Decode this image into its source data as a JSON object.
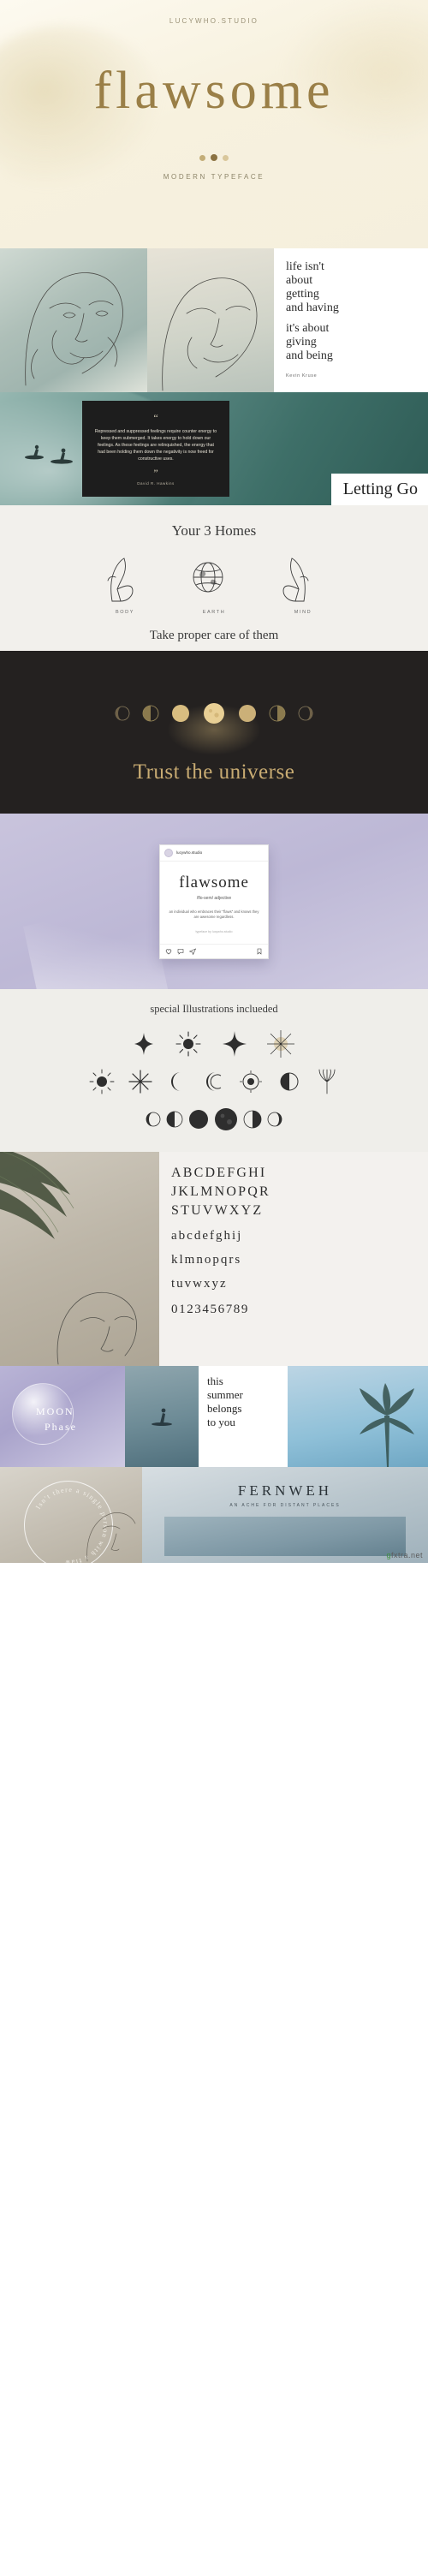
{
  "hero": {
    "brand": "LUCYWHO.STUDIO",
    "title": "flawsome",
    "subtitle": "MODERN TYPEFACE",
    "accent": "#9a7f47",
    "bg": "#f5efdd"
  },
  "quote_section": {
    "lines": [
      "life isn't",
      "about",
      "getting",
      "and having",
      "it's about",
      "giving",
      "and being"
    ],
    "author": "Kevin Kruse"
  },
  "dark_quote": {
    "open_mark": "“",
    "text": "Repressed and suppressed feelings require counter energy to keep them submerged. It takes energy to hold down our feelings. As these feelings are relinquished, the energy that had been holding them down the negativity is now freed for constructive uses.",
    "close_mark": "”",
    "author": "David R. Hawkins",
    "overlay_title": "Letting Go",
    "card_bg": "#1d1d1d"
  },
  "homes": {
    "title": "Your 3 Homes",
    "items": [
      {
        "icon": "hand-body-icon",
        "caption": "BODY"
      },
      {
        "icon": "earth-globe-icon",
        "caption": "EARTH"
      },
      {
        "icon": "hand-mind-icon",
        "caption": "MIND"
      }
    ],
    "footer": "Take proper care of them"
  },
  "universe": {
    "title": "Trust the universe",
    "bg": "#242120",
    "accent": "#c8ab72",
    "moon_count": 7
  },
  "instagram": {
    "username": "lucywho.studio",
    "word": "flawsome",
    "pronunciation": "/flo-sem/   adjective",
    "definition": "an individual who embraces their \"flaws\" and knows they are awesome regardless.",
    "credit": "typeface by lucywho.studio",
    "actions": [
      "heart-icon",
      "comment-icon",
      "share-icon",
      "bookmark-icon"
    ]
  },
  "illustrations": {
    "title": "special Illustrations inclueded",
    "row1": [
      "four-point-star-icon",
      "sun-rays-icon",
      "sparkle-star-icon",
      "radial-burst-icon"
    ],
    "row2": [
      "sun-burst-icon",
      "starburst-icon",
      "crescent-moon-icon",
      "double-crescent-icon",
      "sun-face-icon",
      "moon-circle-icon",
      "palm-leaf-icon"
    ],
    "row3": [
      "moon-phase-1",
      "moon-phase-2",
      "moon-phase-3",
      "moon-phase-4",
      "moon-phase-5",
      "moon-phase-6"
    ]
  },
  "alphabet": {
    "uppercase": [
      "ABCDEFGHI",
      "JKLMNOPQR",
      "STUVWXYZ"
    ],
    "lowercase": [
      "abcdefghij",
      "klmnopqrs",
      "tuvwxyz"
    ],
    "numbers": "0123456789"
  },
  "moon_phase": {
    "line1": "MOON",
    "line2": "Phase"
  },
  "summer": {
    "lines": [
      "this",
      "summer",
      "belongs",
      "to you"
    ]
  },
  "badge": {
    "text": "Isn't there a single person with a flaw"
  },
  "fernweh": {
    "title": "FERNWEH",
    "subtitle": "AN ACHE FOR DISTANT PLACES"
  },
  "watermark": {
    "prefix": "g",
    "text": "fxtra.net"
  }
}
